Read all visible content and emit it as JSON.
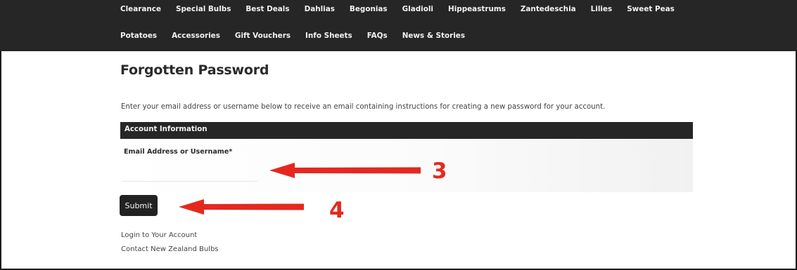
{
  "nav": {
    "row1": [
      "Clearance",
      "Special Bulbs",
      "Best Deals",
      "Dahlias",
      "Begonias",
      "Gladioli",
      "Hippeastrums",
      "Zantedeschia",
      "Lilies",
      "Sweet Peas"
    ],
    "row2": [
      "Potatoes",
      "Accessories",
      "Gift Vouchers",
      "Info Sheets",
      "FAQs",
      "News & Stories"
    ]
  },
  "page": {
    "title": "Forgotten Password",
    "intro": "Enter your email address or username below to receive an email containing instructions for creating a new password for your account."
  },
  "account_section": {
    "title": "Account Information",
    "field_label": "Email Address or Username*",
    "field_value": "",
    "submit_label": "Submit"
  },
  "links": {
    "login": "Login to Your Account",
    "contact": "Contact New Zealand Bulbs"
  },
  "annotations": {
    "step3": "3",
    "step4": "4",
    "arrow_color": "#e5281f"
  },
  "colors": {
    "nav_bg": "#262626",
    "section_bg": "#262626",
    "button_bg": "#222222"
  }
}
